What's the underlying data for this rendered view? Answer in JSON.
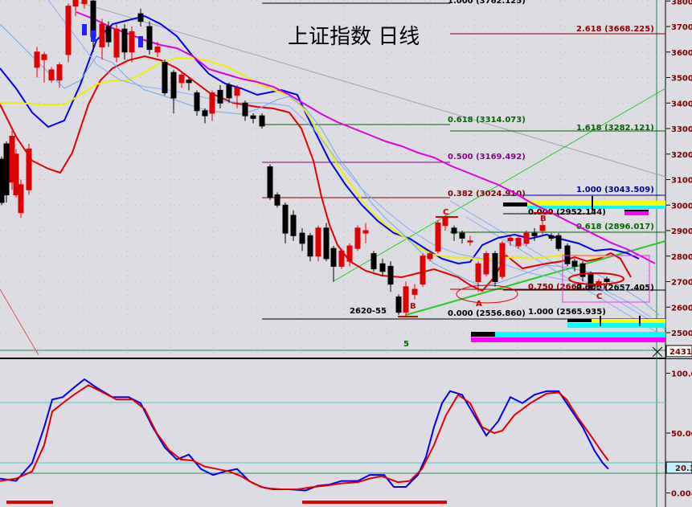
{
  "chart_data": [
    {
      "type": "candlestick",
      "title": "上证指数  日线",
      "ylim": [
        2431,
        3862
      ],
      "y_ticks": [
        "3800",
        "3700",
        "3600",
        "3500",
        "3400",
        "3300",
        "3200",
        "3100",
        "3000",
        "2900",
        "2800",
        "2700",
        "2600",
        "2500"
      ],
      "current_value": "2431.",
      "colors": {
        "up": "#e00000",
        "down": "#000000",
        "ma_fast": "#e00000",
        "ma_mid": "#0000ee",
        "ma_slow": "#eeee00",
        "ma_long": "#dd00dd"
      },
      "candles": [
        [
          2,
          3180,
          3010,
          3000,
          3190
        ],
        [
          8,
          3240,
          3040,
          3010,
          3250
        ],
        [
          15,
          3090,
          3270,
          3060,
          3290
        ],
        [
          20,
          3040,
          3200,
          3030,
          3220
        ],
        [
          26,
          2970,
          3080,
          2950,
          3100
        ],
        [
          36,
          3060,
          3220,
          3040,
          3240
        ],
        [
          46,
          3540,
          3600,
          3500,
          3620
        ],
        [
          55,
          3570,
          3590,
          3480,
          3600
        ],
        [
          64,
          3490,
          3530,
          3480,
          3540
        ],
        [
          74,
          3490,
          3550,
          3460,
          3560
        ],
        [
          85,
          3590,
          3780,
          3560,
          3790
        ],
        [
          94,
          3780,
          3830,
          3740,
          3850
        ],
        [
          105,
          3790,
          3820,
          3770,
          3840
        ],
        [
          116,
          3800,
          3660,
          3600,
          3810
        ],
        [
          127,
          3620,
          3710,
          3570,
          3730
        ],
        [
          135,
          3700,
          3640,
          3620,
          3720
        ],
        [
          145,
          3580,
          3690,
          3560,
          3710
        ],
        [
          155,
          3690,
          3600,
          3570,
          3710
        ],
        [
          164,
          3600,
          3680,
          3560,
          3700
        ],
        [
          175,
          3750,
          3720,
          3700,
          3770
        ],
        [
          186,
          3700,
          3610,
          3590,
          3720
        ],
        [
          196,
          3600,
          3620,
          3580,
          3640
        ],
        [
          205,
          3560,
          3440,
          3430,
          3570
        ],
        [
          216,
          3520,
          3420,
          3360,
          3530
        ],
        [
          226,
          3480,
          3510,
          3460,
          3520
        ],
        [
          235,
          3490,
          3480,
          3450,
          3500
        ],
        [
          245,
          3440,
          3370,
          3350,
          3450
        ],
        [
          255,
          3370,
          3350,
          3320,
          3380
        ],
        [
          264,
          3360,
          3440,
          3330,
          3450
        ],
        [
          274,
          3450,
          3400,
          3380,
          3470
        ],
        [
          285,
          3470,
          3420,
          3400,
          3480
        ],
        [
          295,
          3430,
          3460,
          3380,
          3470
        ],
        [
          305,
          3400,
          3350,
          3330,
          3410
        ],
        [
          315,
          3350,
          3340,
          3320,
          3360
        ],
        [
          326,
          3350,
          3310,
          3300,
          3360
        ],
        [
          336,
          3150,
          3030,
          3020,
          3160
        ],
        [
          345,
          3040,
          3000,
          2990,
          3050
        ],
        [
          355,
          3000,
          2890,
          2850,
          3010
        ],
        [
          365,
          2960,
          2880,
          2860,
          2980
        ],
        [
          376,
          2890,
          2850,
          2820,
          2910
        ],
        [
          386,
          2880,
          2800,
          2780,
          2890
        ],
        [
          396,
          2800,
          2910,
          2780,
          2920
        ],
        [
          406,
          2910,
          2790,
          2780,
          2930
        ],
        [
          415,
          2830,
          2760,
          2700,
          2840
        ],
        [
          425,
          2760,
          2820,
          2750,
          2830
        ],
        [
          435,
          2780,
          2840,
          2760,
          2850
        ],
        [
          445,
          2830,
          2910,
          2820,
          2920
        ],
        [
          455,
          2890,
          2900,
          2850,
          2930
        ],
        [
          465,
          2810,
          2750,
          2740,
          2820
        ],
        [
          476,
          2770,
          2740,
          2720,
          2790
        ],
        [
          486,
          2760,
          2690,
          2660,
          2780
        ],
        [
          496,
          2640,
          2580,
          2570,
          2650
        ],
        [
          505,
          2580,
          2680,
          2560,
          2700
        ],
        [
          516,
          2650,
          2670,
          2630,
          2690
        ],
        [
          526,
          2690,
          2800,
          2680,
          2810
        ],
        [
          535,
          2790,
          2810,
          2780,
          2820
        ],
        [
          545,
          2820,
          2930,
          2810,
          2940
        ],
        [
          554,
          2920,
          2950,
          2900,
          2960
        ],
        [
          565,
          2910,
          2890,
          2860,
          2920
        ],
        [
          575,
          2890,
          2870,
          2850,
          2900
        ],
        [
          585,
          2860,
          2860,
          2840,
          2880
        ],
        [
          595,
          2700,
          2770,
          2660,
          2780
        ],
        [
          605,
          2730,
          2810,
          2720,
          2820
        ],
        [
          616,
          2810,
          2700,
          2680,
          2820
        ],
        [
          625,
          2720,
          2850,
          2710,
          2860
        ],
        [
          635,
          2860,
          2870,
          2840,
          2880
        ],
        [
          645,
          2840,
          2870,
          2830,
          2880
        ],
        [
          655,
          2850,
          2890,
          2840,
          2900
        ],
        [
          665,
          2890,
          2880,
          2860,
          2910
        ],
        [
          675,
          2900,
          2920,
          2880,
          2940
        ],
        [
          686,
          2880,
          2870,
          2860,
          2890
        ],
        [
          695,
          2880,
          2830,
          2820,
          2890
        ],
        [
          706,
          2840,
          2770,
          2760,
          2850
        ],
        [
          715,
          2780,
          2760,
          2740,
          2790
        ],
        [
          725,
          2770,
          2720,
          2700,
          2780
        ],
        [
          735,
          2730,
          2680,
          2670,
          2740
        ],
        [
          745,
          2690,
          2700,
          2680,
          2710
        ],
        [
          755,
          2710,
          2700,
          2690,
          2720
        ]
      ],
      "fib_levels": [
        {
          "label": "1.000 (3762.125)",
          "color": "#000000"
        },
        {
          "label": "2.618 (3668.225)",
          "color": "#8b0000"
        },
        {
          "label": "0.618 (3314.073)",
          "color": "#006400"
        },
        {
          "label": "1.618 (3282.121)",
          "color": "#006400"
        },
        {
          "label": "0.500 (3169.492)",
          "color": "#8b008b"
        },
        {
          "label": "1.000 (3043.509)",
          "color": "#00008b"
        },
        {
          "label": "0.382 (3024.910)",
          "color": "#8b0000"
        },
        {
          "label": "0.000 (2952.144)",
          "color": "#000000"
        },
        {
          "label": "0.618 (2896.017)",
          "color": "#006400"
        },
        {
          "label": "0.750 (2662.998)",
          "color": "#8b0000"
        },
        {
          "label": "0.000 (2657.405)",
          "color": "#000000"
        },
        {
          "label": "1.000 (2565.935)",
          "color": "#000000"
        },
        {
          "label": "0.000 (2556.860)",
          "color": "#000000"
        }
      ],
      "annotations": {
        "low_label": "2620-55",
        "wave_c1": "C",
        "wave_b1": "B",
        "wave_a": "A",
        "wave_b2": "B",
        "wave_c2": "C",
        "count": "5"
      }
    },
    {
      "type": "line",
      "ylim": [
        -5,
        110
      ],
      "y_ticks": [
        "100.0",
        "50.00",
        "0.00"
      ],
      "current_value": "20.3",
      "series": [
        {
          "color": "#0000ee",
          "values": [
            [
              0,
              12
            ],
            [
              20,
              10
            ],
            [
              40,
              25
            ],
            [
              55,
              55
            ],
            [
              65,
              78
            ],
            [
              78,
              80
            ],
            [
              92,
              88
            ],
            [
              105,
              95
            ],
            [
              120,
              88
            ],
            [
              140,
              80
            ],
            [
              160,
              80
            ],
            [
              175,
              75
            ],
            [
              190,
              55
            ],
            [
              205,
              38
            ],
            [
              220,
              28
            ],
            [
              235,
              32
            ],
            [
              250,
              20
            ],
            [
              265,
              15
            ],
            [
              280,
              18
            ],
            [
              295,
              20
            ],
            [
              310,
              10
            ],
            [
              325,
              5
            ],
            [
              340,
              3
            ],
            [
              360,
              3
            ],
            [
              380,
              2
            ],
            [
              395,
              6
            ],
            [
              410,
              7
            ],
            [
              425,
              10
            ],
            [
              445,
              10
            ],
            [
              460,
              15
            ],
            [
              478,
              15
            ],
            [
              490,
              5
            ],
            [
              505,
              5
            ],
            [
              520,
              15
            ],
            [
              530,
              30
            ],
            [
              540,
              55
            ],
            [
              550,
              75
            ],
            [
              560,
              85
            ],
            [
              575,
              82
            ],
            [
              590,
              65
            ],
            [
              605,
              48
            ],
            [
              620,
              60
            ],
            [
              635,
              80
            ],
            [
              650,
              75
            ],
            [
              665,
              82
            ],
            [
              680,
              85
            ],
            [
              695,
              85
            ],
            [
              710,
              70
            ],
            [
              725,
              55
            ],
            [
              740,
              35
            ],
            [
              750,
              25
            ],
            [
              757,
              20
            ]
          ]
        },
        {
          "color": "#e00000",
          "values": [
            [
              0,
              10
            ],
            [
              20,
              12
            ],
            [
              40,
              18
            ],
            [
              55,
              40
            ],
            [
              65,
              68
            ],
            [
              78,
              75
            ],
            [
              92,
              82
            ],
            [
              110,
              90
            ],
            [
              125,
              85
            ],
            [
              145,
              78
            ],
            [
              165,
              78
            ],
            [
              180,
              70
            ],
            [
              195,
              50
            ],
            [
              210,
              36
            ],
            [
              225,
              28
            ],
            [
              240,
              27
            ],
            [
              255,
              22
            ],
            [
              270,
              20
            ],
            [
              285,
              18
            ],
            [
              300,
              14
            ],
            [
              315,
              8
            ],
            [
              330,
              4
            ],
            [
              350,
              3
            ],
            [
              370,
              3
            ],
            [
              390,
              5
            ],
            [
              405,
              6
            ],
            [
              425,
              8
            ],
            [
              445,
              9
            ],
            [
              460,
              12
            ],
            [
              475,
              14
            ],
            [
              495,
              9
            ],
            [
              510,
              10
            ],
            [
              525,
              20
            ],
            [
              540,
              40
            ],
            [
              555,
              65
            ],
            [
              570,
              82
            ],
            [
              585,
              75
            ],
            [
              600,
              55
            ],
            [
              615,
              50
            ],
            [
              625,
              52
            ],
            [
              640,
              65
            ],
            [
              660,
              75
            ],
            [
              680,
              83
            ],
            [
              695,
              84
            ],
            [
              705,
              78
            ],
            [
              720,
              62
            ],
            [
              735,
              48
            ],
            [
              748,
              35
            ],
            [
              757,
              27
            ]
          ]
        }
      ]
    }
  ]
}
